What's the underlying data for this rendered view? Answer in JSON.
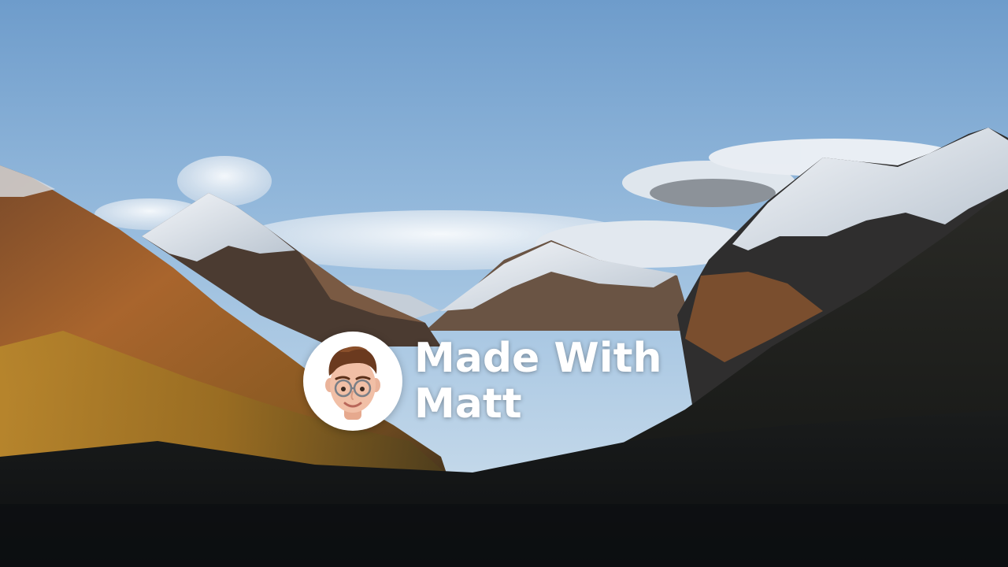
{
  "brand": {
    "line1": "Made With",
    "line2": "Matt"
  },
  "avatar": {
    "icon": "memoji-face-icon"
  },
  "colors": {
    "sky_top": "#6f9fcd",
    "sky_bottom": "#c9dcec",
    "snow": "#eef2f6",
    "rock": "#5a4536",
    "autumn_slope": "#a9652d",
    "shadow": "#0e1114",
    "title_text": "#ffffff",
    "avatar_bg": "#ffffff"
  }
}
